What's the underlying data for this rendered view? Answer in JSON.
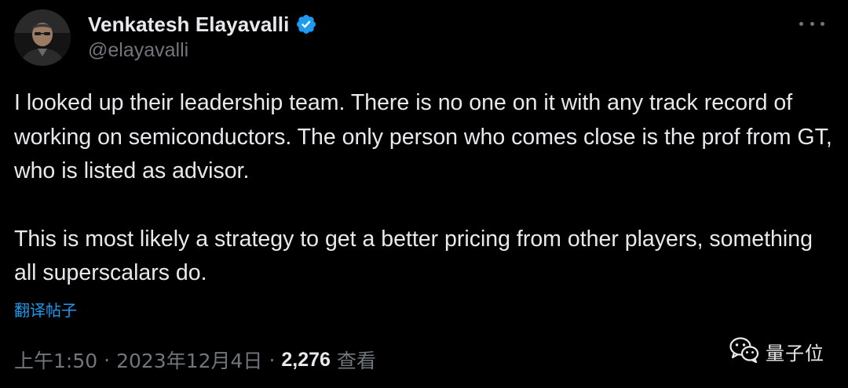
{
  "author": {
    "display_name": "Venkatesh Elayavalli",
    "handle": "@elayavalli",
    "verified": true
  },
  "tweet": {
    "paragraphs": [
      "I looked up their leadership team. There is no one on it with any track record of working on semiconductors. The only person who comes close is the prof from GT, who is listed as advisor.",
      "This is most likely a strategy to get a better pricing from other players, something all superscalars do."
    ],
    "translate_label": "翻译帖子"
  },
  "meta": {
    "time": "上午1:50",
    "separator": "·",
    "date": "2023年12月4日",
    "views_count": "2,276",
    "views_label": "查看"
  },
  "watermark": {
    "text": "量子位",
    "icon": "wechat-icon"
  },
  "icons": {
    "more": "more-options-icon",
    "verified": "verified-badge-icon"
  },
  "colors": {
    "background": "#000000",
    "text_primary": "#e7e9ea",
    "text_secondary": "#71767b",
    "link_blue": "#1d9bf0",
    "verified_blue": "#1d9bf0"
  }
}
